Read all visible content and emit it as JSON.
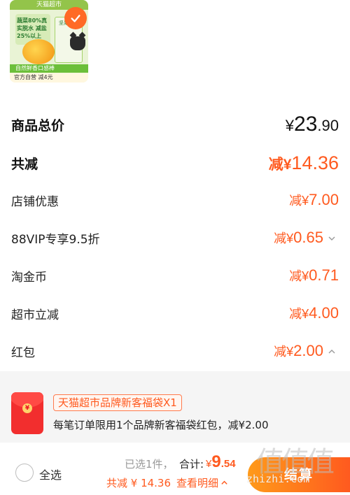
{
  "product": {
    "top_banner": "天猫超市",
    "promo_lines": "蔬菜80%真实脱水 减盐25%以上",
    "bag_label": "坚果良品",
    "bottom_band": "自然鲜香口感棒",
    "badges": "官方自营 减4元"
  },
  "summary": {
    "total_label": "商品总价",
    "total_currency": "¥",
    "total_int": "23",
    "total_dec": ".90",
    "saved_label": "共减",
    "saved_prefix": "减¥",
    "saved_value": "14.36"
  },
  "discounts": [
    {
      "label": "店铺优惠",
      "prefix": "减¥",
      "value": "7.00"
    },
    {
      "label": "88VIP专享9.5折",
      "prefix": "减¥",
      "value": "0.65"
    },
    {
      "label": "淘金币",
      "prefix": "减¥",
      "value": "0.71"
    },
    {
      "label": "超市立减",
      "prefix": "减¥",
      "value": "4.00"
    },
    {
      "label": "红包",
      "prefix": "减¥",
      "value": "2.00"
    }
  ],
  "coupon": {
    "tag": "天猫超市品牌新客福袋X1",
    "description": "每笔订单限用1个品牌新客福袋红包，减¥2.00",
    "coin_symbol": "¥"
  },
  "footer": {
    "select_all": "全选",
    "selected_count": "已选1件，",
    "sum_label": "合计:",
    "sum_currency": "¥",
    "sum_int": "9",
    "sum_dec": ".54",
    "saved_text": "共减 ¥ 14.36",
    "details_label": "查看明细",
    "submit_label": "结算"
  },
  "watermark": {
    "glyphs": "值值值",
    "site": "zhizhi.com"
  },
  "colors": {
    "accent": "#ff5a1f",
    "checkmark": "#ff6a26",
    "envelope": "#f22e2e"
  },
  "icons": [
    "check-icon",
    "chevron-down-icon",
    "chevron-up-icon",
    "red-envelope-icon"
  ]
}
